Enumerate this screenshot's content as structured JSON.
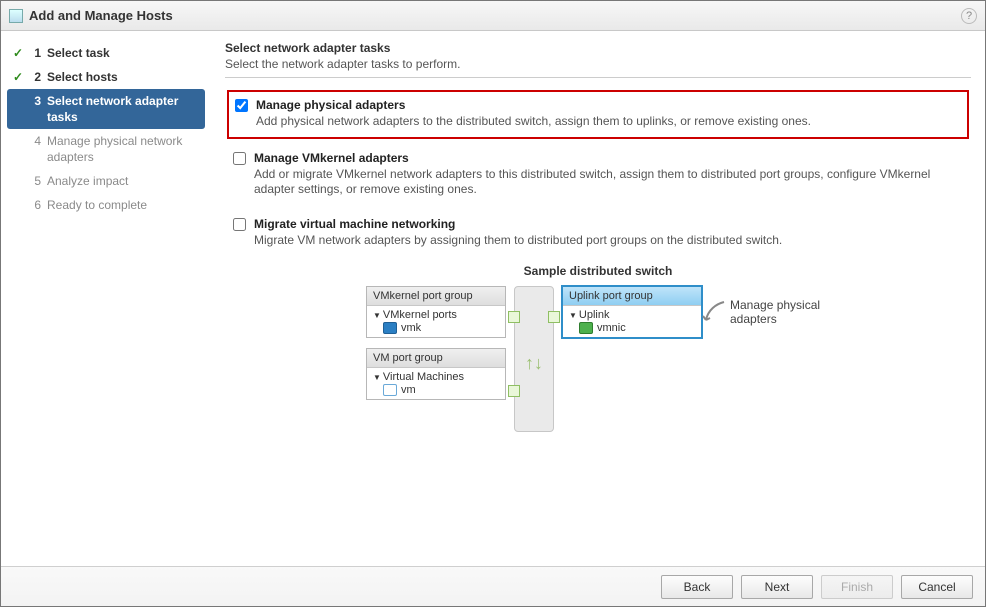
{
  "title": "Add and Manage Hosts",
  "steps": [
    {
      "num": "1",
      "label": "Select task",
      "status": "done"
    },
    {
      "num": "2",
      "label": "Select hosts",
      "status": "done"
    },
    {
      "num": "3",
      "label": "Select network adapter tasks",
      "status": "current"
    },
    {
      "num": "4",
      "label": "Manage physical network adapters",
      "status": "future"
    },
    {
      "num": "5",
      "label": "Analyze impact",
      "status": "future"
    },
    {
      "num": "6",
      "label": "Ready to complete",
      "status": "future"
    }
  ],
  "main": {
    "heading": "Select network adapter tasks",
    "subheading": "Select the network adapter tasks to perform.",
    "tasks": [
      {
        "checked": true,
        "highlight": true,
        "title": "Manage physical adapters",
        "desc": "Add physical network adapters to the distributed switch, assign them to uplinks, or remove existing ones."
      },
      {
        "checked": false,
        "highlight": false,
        "title": "Manage VMkernel adapters",
        "desc": "Add or migrate VMkernel network adapters to this distributed switch, assign them to distributed port groups, configure VMkernel adapter settings, or remove existing ones."
      },
      {
        "checked": false,
        "highlight": false,
        "title": "Migrate virtual machine networking",
        "desc": "Migrate VM network adapters by assigning them to distributed port groups on the distributed switch."
      }
    ],
    "sample": {
      "title": "Sample distributed switch",
      "vmkernel_group": "VMkernel port group",
      "vmkernel_ports_label": "VMkernel ports",
      "vmk_item": "vmk",
      "vm_group": "VM port group",
      "vms_label": "Virtual Machines",
      "vm_item": "vm",
      "uplink_group": "Uplink port group",
      "uplink_label": "Uplink",
      "vmnic_item": "vmnic",
      "callout": "Manage physical adapters"
    }
  },
  "buttons": {
    "back": "Back",
    "next": "Next",
    "finish": "Finish",
    "cancel": "Cancel"
  }
}
